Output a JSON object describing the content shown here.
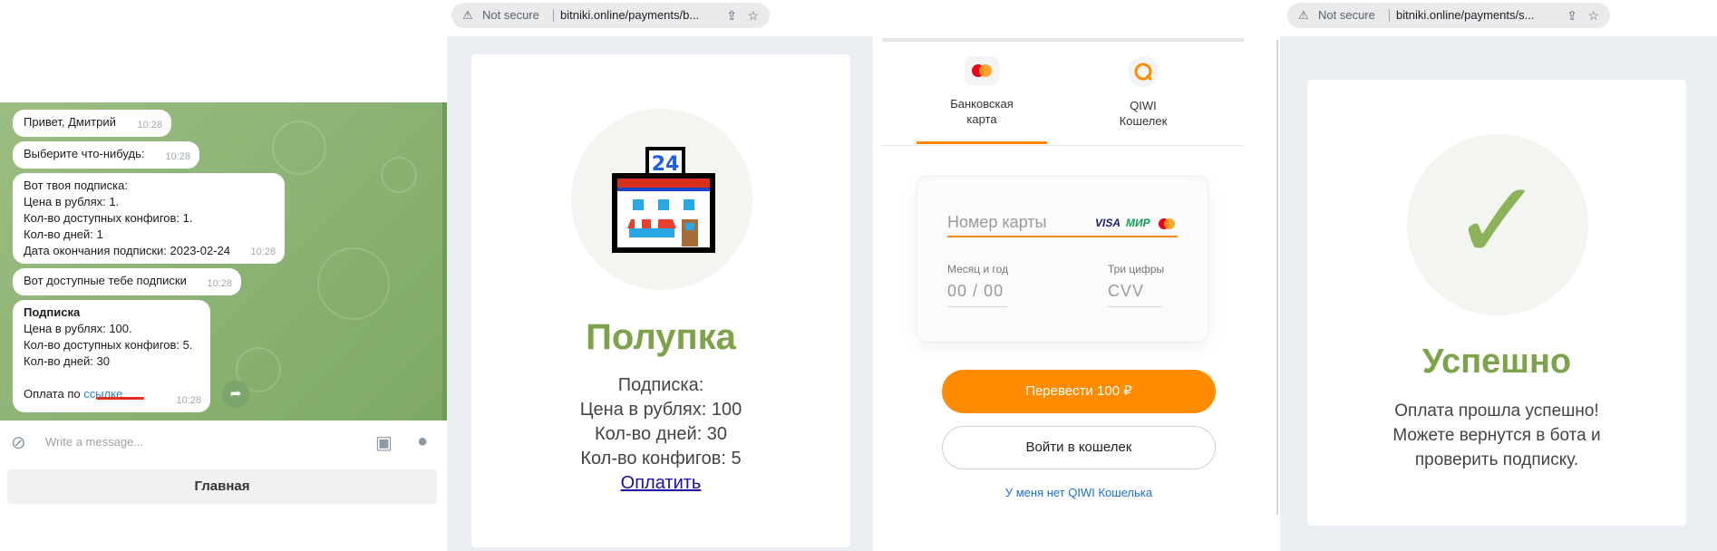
{
  "telegram": {
    "messages": [
      {
        "lines": [
          "Привет, Дмитрий"
        ],
        "time": "10:28"
      },
      {
        "lines": [
          "Выберите что-нибудь:"
        ],
        "time": "10:28"
      },
      {
        "lines": [
          "Вот твоя подписка:",
          "Цена в рублях: 1.",
          "Кол-во доступных конфигов: 1.",
          "Кол-во дней: 1",
          "Дата окончания подписки: 2023-02-24"
        ],
        "time": "10:28"
      },
      {
        "lines": [
          "Вот доступные тебе подписки"
        ],
        "time": "10:28"
      },
      {
        "title": "Подписка",
        "lines": [
          "Цена в рублях: 100.",
          "Кол-во доступных конфигов: 5.",
          "Кол-во дней: 30"
        ],
        "pay_prefix": "Оплата по",
        "pay_link": "ссылке",
        "time": "10:28"
      }
    ],
    "input_placeholder": "Write a message...",
    "home_button": "Главная"
  },
  "browser": {
    "not_secure": "Not secure",
    "url_payment": "bitniki.online/payments/b...",
    "url_success": "bitniki.online/payments/s..."
  },
  "shop": {
    "sign_number": "24",
    "title": "Полупка",
    "lines": [
      "Подписка:",
      "Цена в рублях: 100",
      "Кол-во дней: 30",
      "Кол-во конфигов: 5"
    ],
    "pay_link": "Оплатить"
  },
  "qiwi": {
    "tabs": [
      {
        "label_line1": "Банковская",
        "label_line2": "карта",
        "icon": "mastercard-icon"
      },
      {
        "label_line1": "QIWI",
        "label_line2": "Кошелек",
        "icon": "qiwi-icon"
      }
    ],
    "card_number_placeholder": "Номер карты",
    "brands": {
      "visa": "VISA",
      "mir": "МИР"
    },
    "expiry_label": "Месяц и год",
    "expiry_month": "00",
    "expiry_sep": "/",
    "expiry_year": "00",
    "cvv_label": "Три цифры",
    "cvv_placeholder": "CVV",
    "transfer_button": "Перевести 100 ₽",
    "wallet_login_button": "Войти в кошелек",
    "no_wallet_link": "У меня нет QIWI Кошелька",
    "accent_color": "#ff8c00"
  },
  "success": {
    "title": "Успешно",
    "lines": [
      "Оплата прошла успешно!",
      "Можете вернутся в бота и",
      "проверить подписку."
    ]
  }
}
